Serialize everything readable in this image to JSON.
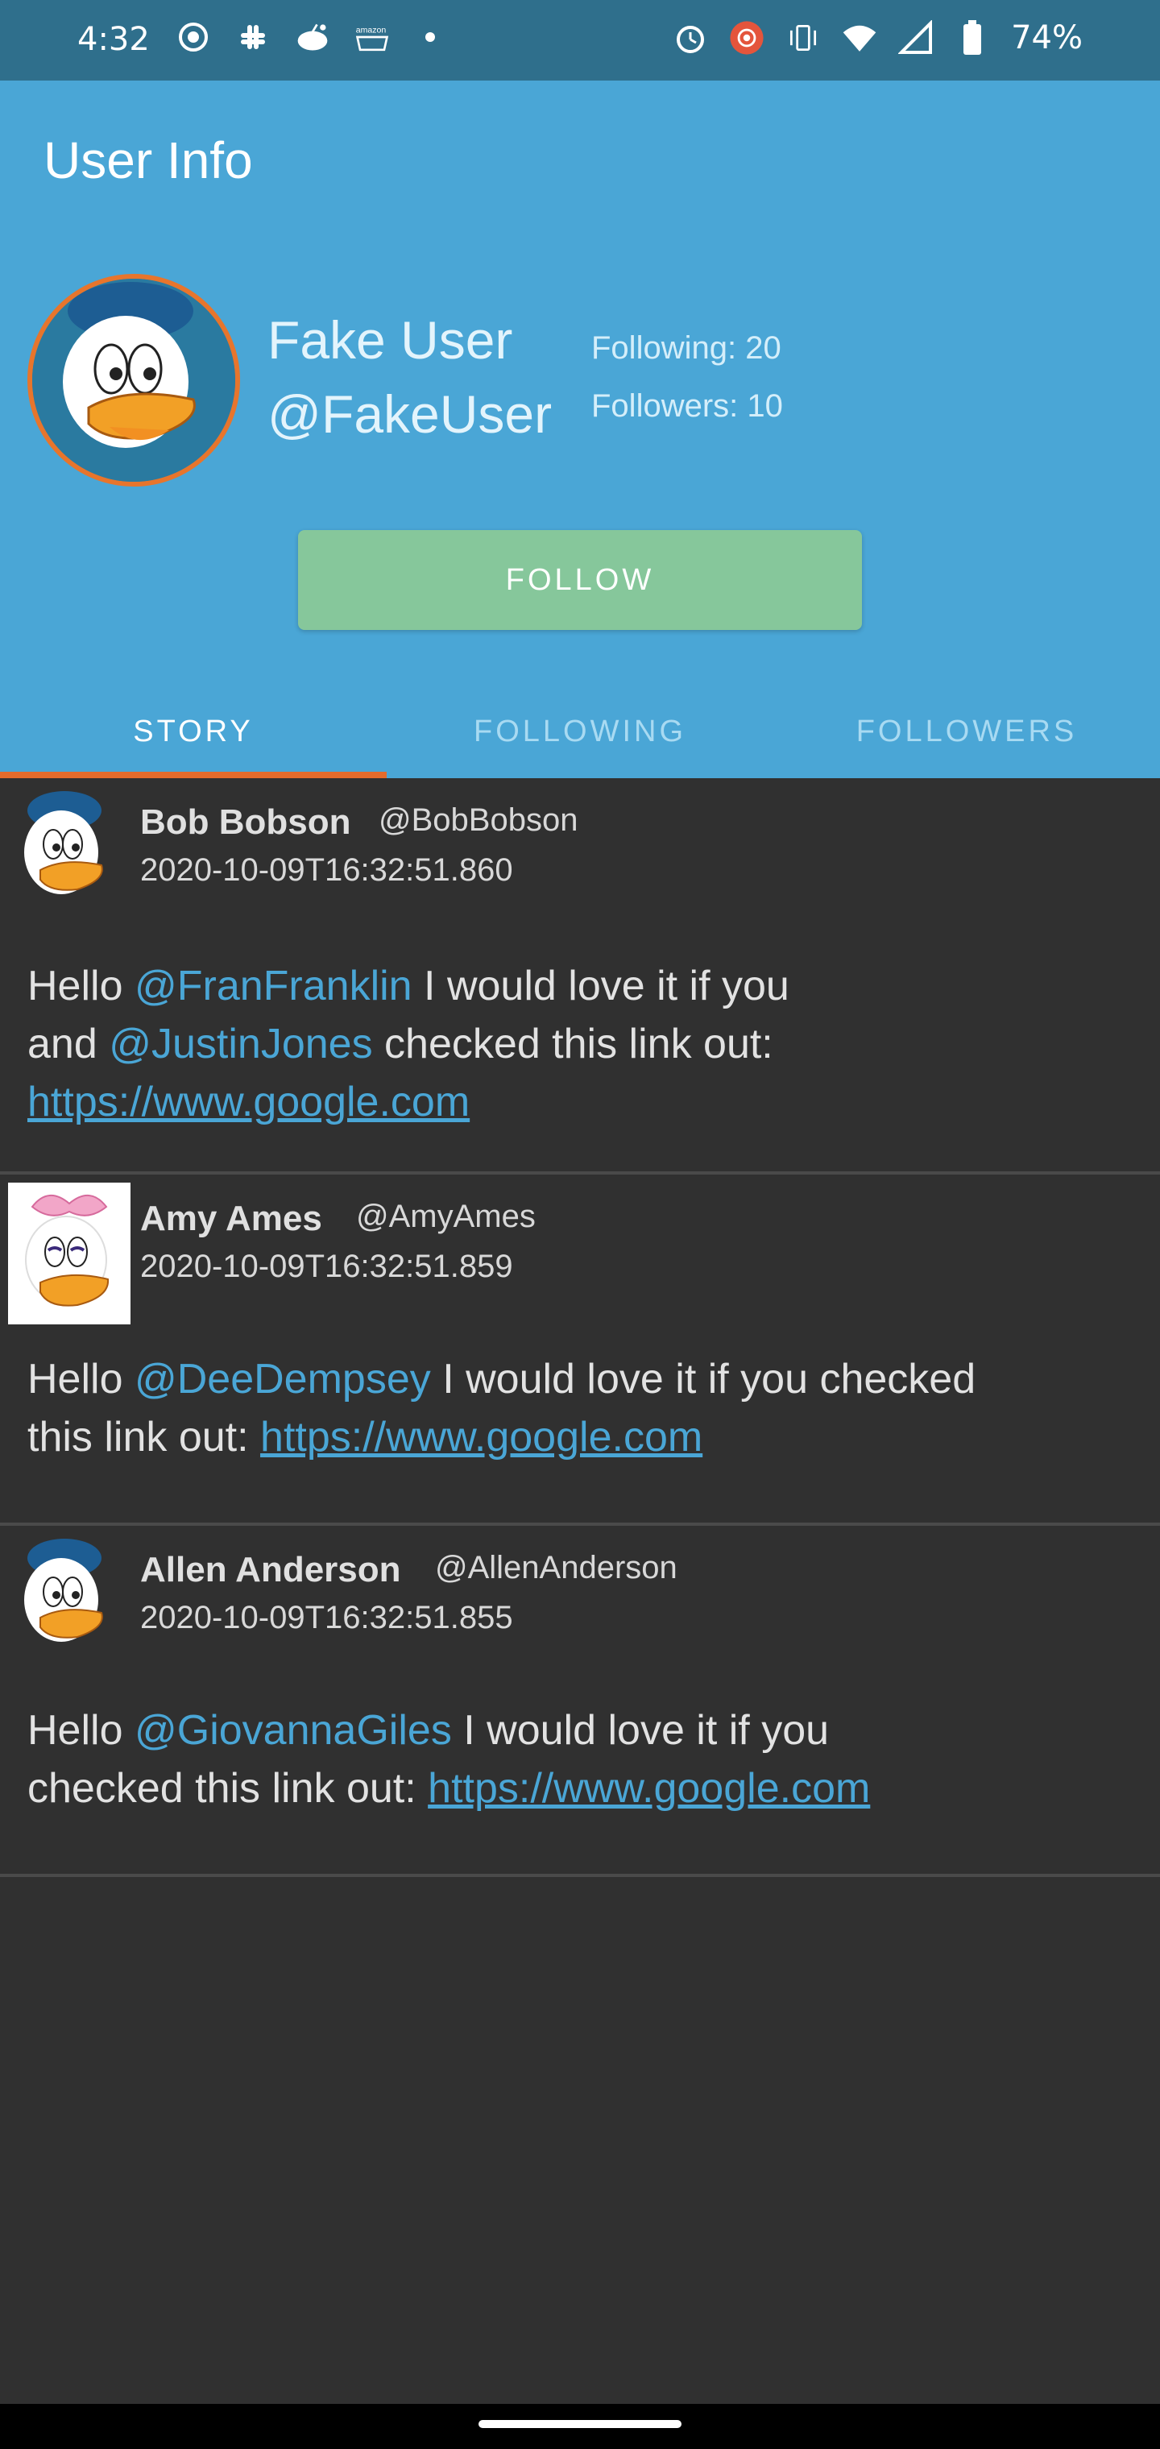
{
  "status_bar": {
    "time": "4:32",
    "battery": "74%",
    "left_icons": [
      "screen-record-icon",
      "slack-icon",
      "reddit-icon",
      "amazon-icon",
      "notification-dot-icon"
    ],
    "right_icons": [
      "alarm-icon",
      "recording-icon",
      "vibrate-icon",
      "wifi-icon",
      "signal-icon",
      "battery-icon"
    ]
  },
  "header": {
    "title": "User Info",
    "user_name": "Fake User",
    "user_handle": "@FakeUser",
    "following": "Following: 20",
    "followers": "Followers: 10",
    "follow_label": "FOLLOW"
  },
  "tabs": [
    {
      "label": "STORY",
      "active": true
    },
    {
      "label": "FOLLOWING",
      "active": false
    },
    {
      "label": "FOLLOWERS",
      "active": false
    }
  ],
  "posts": [
    {
      "author": "Bob Bobson",
      "handle": "@BobBobson",
      "timestamp": "2020-10-09T16:32:51.860",
      "body": {
        "p1": "Hello ",
        "m1": "@FranFranklin",
        "p2": " I would love it if you",
        "p3": "and ",
        "m2": "@JustinJones",
        "p4": " checked this link out:",
        "link": "https://www.google.com"
      }
    },
    {
      "author": "Amy Ames",
      "handle": "@AmyAmes",
      "timestamp": "2020-10-09T16:32:51.859",
      "body": {
        "p1": "Hello ",
        "m1": "@DeeDempsey",
        "p2": " I would love it if you checked",
        "p3": "this link out: ",
        "link": "https://www.google.com"
      }
    },
    {
      "author": "Allen Anderson",
      "handle": "@AllenAnderson",
      "timestamp": "2020-10-09T16:32:51.855",
      "body": {
        "p1": "Hello ",
        "m1": "@GiovannaGiles",
        "p2": " I would love it if you",
        "p3": "checked this link out: ",
        "link": "https://www.google.com"
      }
    }
  ],
  "colors": {
    "status_bar": "#2f6f8c",
    "header": "#4aa6d6",
    "follow_button": "#86c79b",
    "tab_indicator": "#e46b2b",
    "feed_bg": "#303030",
    "mention": "#4aa6d6"
  }
}
